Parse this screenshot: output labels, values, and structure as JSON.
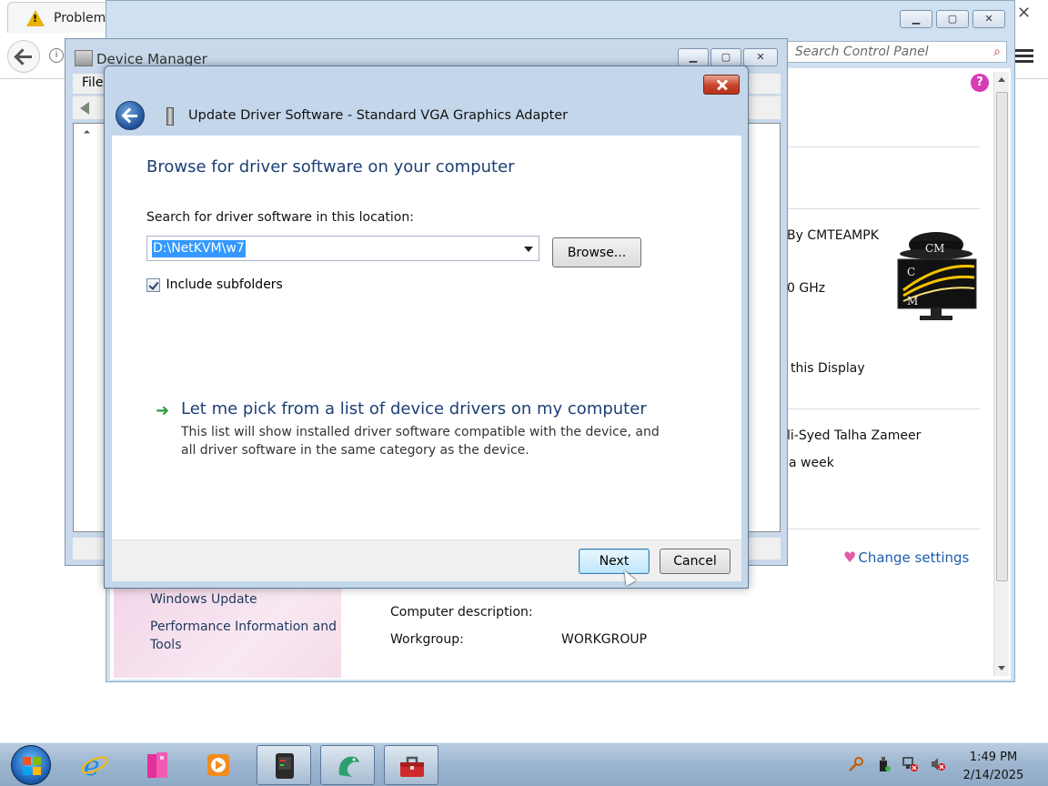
{
  "browser": {
    "tab_title": "Problem"
  },
  "control_panel": {
    "search_placeholder": "Search Control Panel",
    "sidebar_links": [
      "Windows Update",
      "Performance Information and",
      "Tools"
    ],
    "computer_description_label": "Computer description:",
    "workgroup_label": "Workgroup:",
    "workgroup_value": "WORKGROUP",
    "partial_texts": {
      "manufacturer": "By CMTEAMPK",
      "processor": "0 GHz",
      "display": "this Display",
      "computer_name": "li-Syed Talha Zameer",
      "week": "a week"
    },
    "change_settings_label": "Change settings",
    "oem_logo_text": [
      "CM",
      "C",
      "M"
    ]
  },
  "device_manager": {
    "title": "Device Manager",
    "menu_file": "File"
  },
  "dialog": {
    "title": "Update Driver Software - Standard VGA Graphics Adapter",
    "heading": "Browse for driver software on your computer",
    "search_label": "Search for driver software in this location:",
    "path_value": "D:\\NetKVM\\w7",
    "browse_label": "Browse...",
    "include_subfolders_label": "Include subfolders",
    "include_subfolders_checked": true,
    "pick_title": "Let me pick from a list of device drivers on my computer",
    "pick_description": "This list will show installed driver software compatible with the device, and all driver software in the same category as the device.",
    "next_label": "Next",
    "cancel_label": "Cancel"
  },
  "taskbar": {
    "time": "1:49 PM",
    "date": "2/14/2025",
    "items": [
      "start-button",
      "internet-explorer",
      "library",
      "media-player",
      "terminal-app",
      "dragon-app",
      "toolbox-app"
    ]
  },
  "colors": {
    "link": "#1d5cab",
    "heading": "#1d3f74",
    "selection": "#3399ff",
    "green_arrow": "#2e9f3a"
  }
}
